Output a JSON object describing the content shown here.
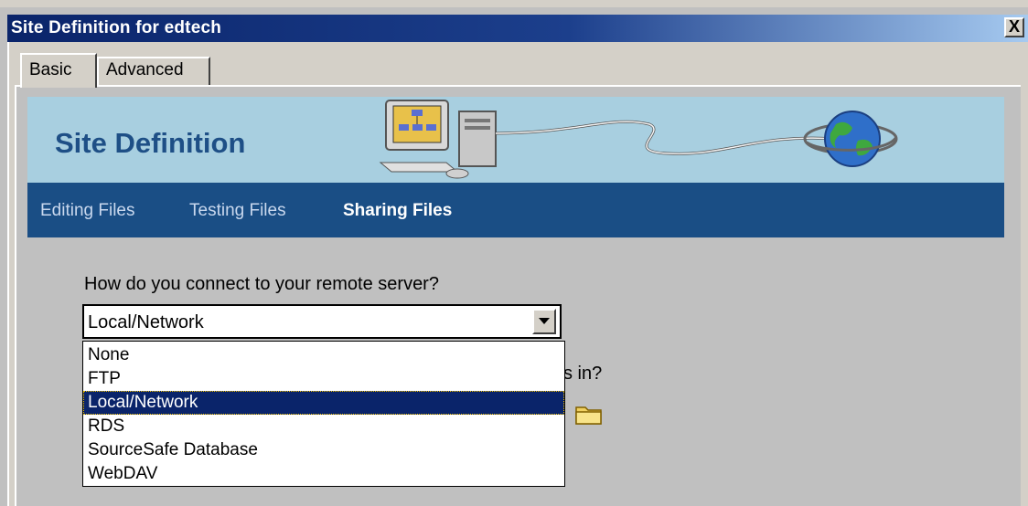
{
  "window": {
    "title": "Site Definition for edtech",
    "close_label": "X"
  },
  "tabs": [
    {
      "label": "Basic",
      "active": true
    },
    {
      "label": "Advanced",
      "active": false
    }
  ],
  "banner": {
    "title": "Site Definition"
  },
  "steps": [
    {
      "label": "Editing Files",
      "active": false
    },
    {
      "label": "Testing Files",
      "active": false
    },
    {
      "label": "Sharing Files",
      "active": true
    }
  ],
  "form": {
    "question": "How do you connect to your remote server?",
    "connection_value": "Local/Network",
    "options": [
      "None",
      "FTP",
      "Local/Network",
      "RDS",
      "SourceSafe Database",
      "WebDAV"
    ],
    "selected_index": 2,
    "partial_question_text": "s in?"
  },
  "icons": [
    "close-icon",
    "computer-icon",
    "globe-icon",
    "dropdown-arrow-icon",
    "folder-icon"
  ],
  "colors": {
    "titlebar": "#0a246a",
    "banner": "#a8cfe0",
    "navbar": "#1a4e85",
    "selection": "#0a246a"
  }
}
